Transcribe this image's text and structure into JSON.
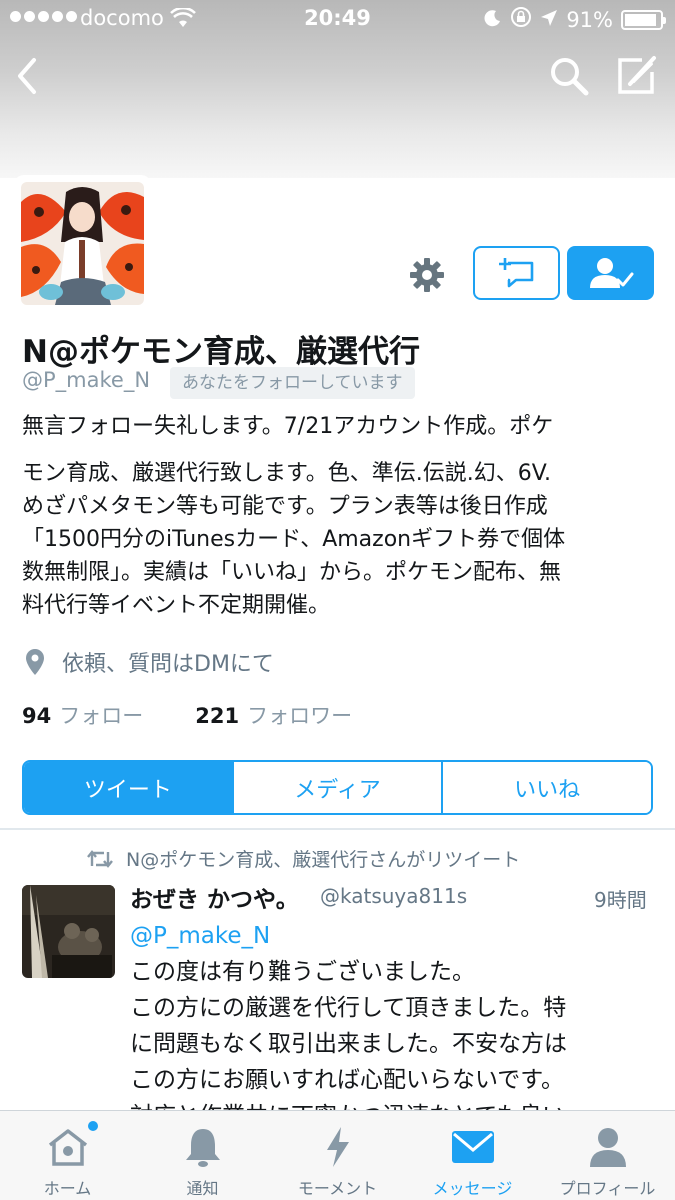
{
  "status_bar": {
    "carrier": "docomo",
    "time": "20:49",
    "battery": "91%",
    "battery_level": 0.91
  },
  "profile": {
    "name": "N@ポケモン育成、厳選代行",
    "handle": "@P_make_N",
    "follows_you": "あなたをフォローしています",
    "bio_lines": [
      "無言フォロー失礼します。7/21アカウント作成。ポケ",
      "モン育成、厳選代行致します。色、準伝.伝説.幻、6V.",
      "めざパメタモン等も可能です。プラン表等は後日作成",
      "「1500円分のiTunesカード、Amazonギフト券で個体",
      "数無制限」。実績は「いいね」から。ポケモン配布、無",
      "料代行等イベント不定期開催。"
    ],
    "location": "依頼、質問はDMにて",
    "following_count": "94",
    "following_label": "フォロー",
    "followers_count": "221",
    "followers_label": "フォロワー"
  },
  "tabs": [
    {
      "label": "ツイート",
      "active": true
    },
    {
      "label": "メディア",
      "active": false
    },
    {
      "label": "いいね",
      "active": false
    }
  ],
  "tweet": {
    "retweet_text": "N@ポケモン育成、厳選代行さんがリツイート",
    "author": "おぜき かつや。",
    "handle": "@katsuya811s",
    "time": "9時間",
    "mention": "@P_make_N",
    "lines": [
      "この度は有り難うございました。",
      "この方にの厳選を代行して頂きました。特",
      "に問題もなく取引出来ました。不安な方は",
      "この方にお願いすれば心配いらないです。",
      "対応と作業共に丁寧かつ迅速なとても良い"
    ]
  },
  "tab_bar": [
    {
      "label": "ホーム",
      "icon": "home-icon"
    },
    {
      "label": "通知",
      "icon": "bell-icon"
    },
    {
      "label": "モーメント",
      "icon": "lightning-icon"
    },
    {
      "label": "メッセージ",
      "icon": "mail-icon"
    },
    {
      "label": "プロフィール",
      "icon": "person-icon"
    }
  ],
  "colors": {
    "accent": "#1da1f2",
    "text": "#14171a",
    "secondary": "#8899a6"
  }
}
